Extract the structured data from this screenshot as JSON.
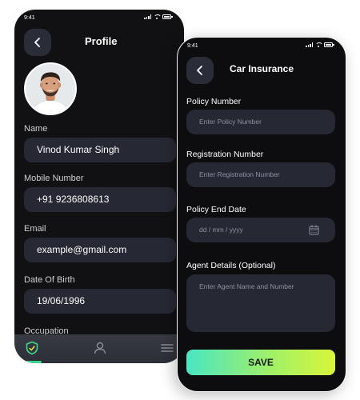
{
  "profile_screen": {
    "status_time": "9:41",
    "title": "Profile",
    "fields": [
      {
        "label": "Name",
        "value": "Vinod Kumar Singh"
      },
      {
        "label": "Mobile Number",
        "value": "+91 9236808613"
      },
      {
        "label": "Email",
        "value": "example@gmail.com"
      },
      {
        "label": "Date Of Birth",
        "value": "19/06/1996"
      },
      {
        "label": "Occupation"
      }
    ],
    "tabs": [
      "shield-icon",
      "user-icon",
      "menu-icon"
    ]
  },
  "insurance_screen": {
    "status_time": "9:41",
    "title": "Car Insurance",
    "fields": [
      {
        "label": "Policy Number",
        "placeholder": "Enter Policy Number"
      },
      {
        "label": "Registration Number",
        "placeholder": "Enter Registration Number"
      },
      {
        "label": "Policy End Date",
        "placeholder": "dd / mm / yyyy"
      },
      {
        "label": "Agent Details (Optional)",
        "placeholder": "Enter Agent Name and  Number"
      }
    ],
    "save_label": "SAVE"
  },
  "colors": {
    "background": "#0e0e10",
    "field": "#262833",
    "accent_gradient_start": "#49e5c3",
    "accent_gradient_end": "#d9f53a",
    "tab_active": "#3dd68c"
  }
}
